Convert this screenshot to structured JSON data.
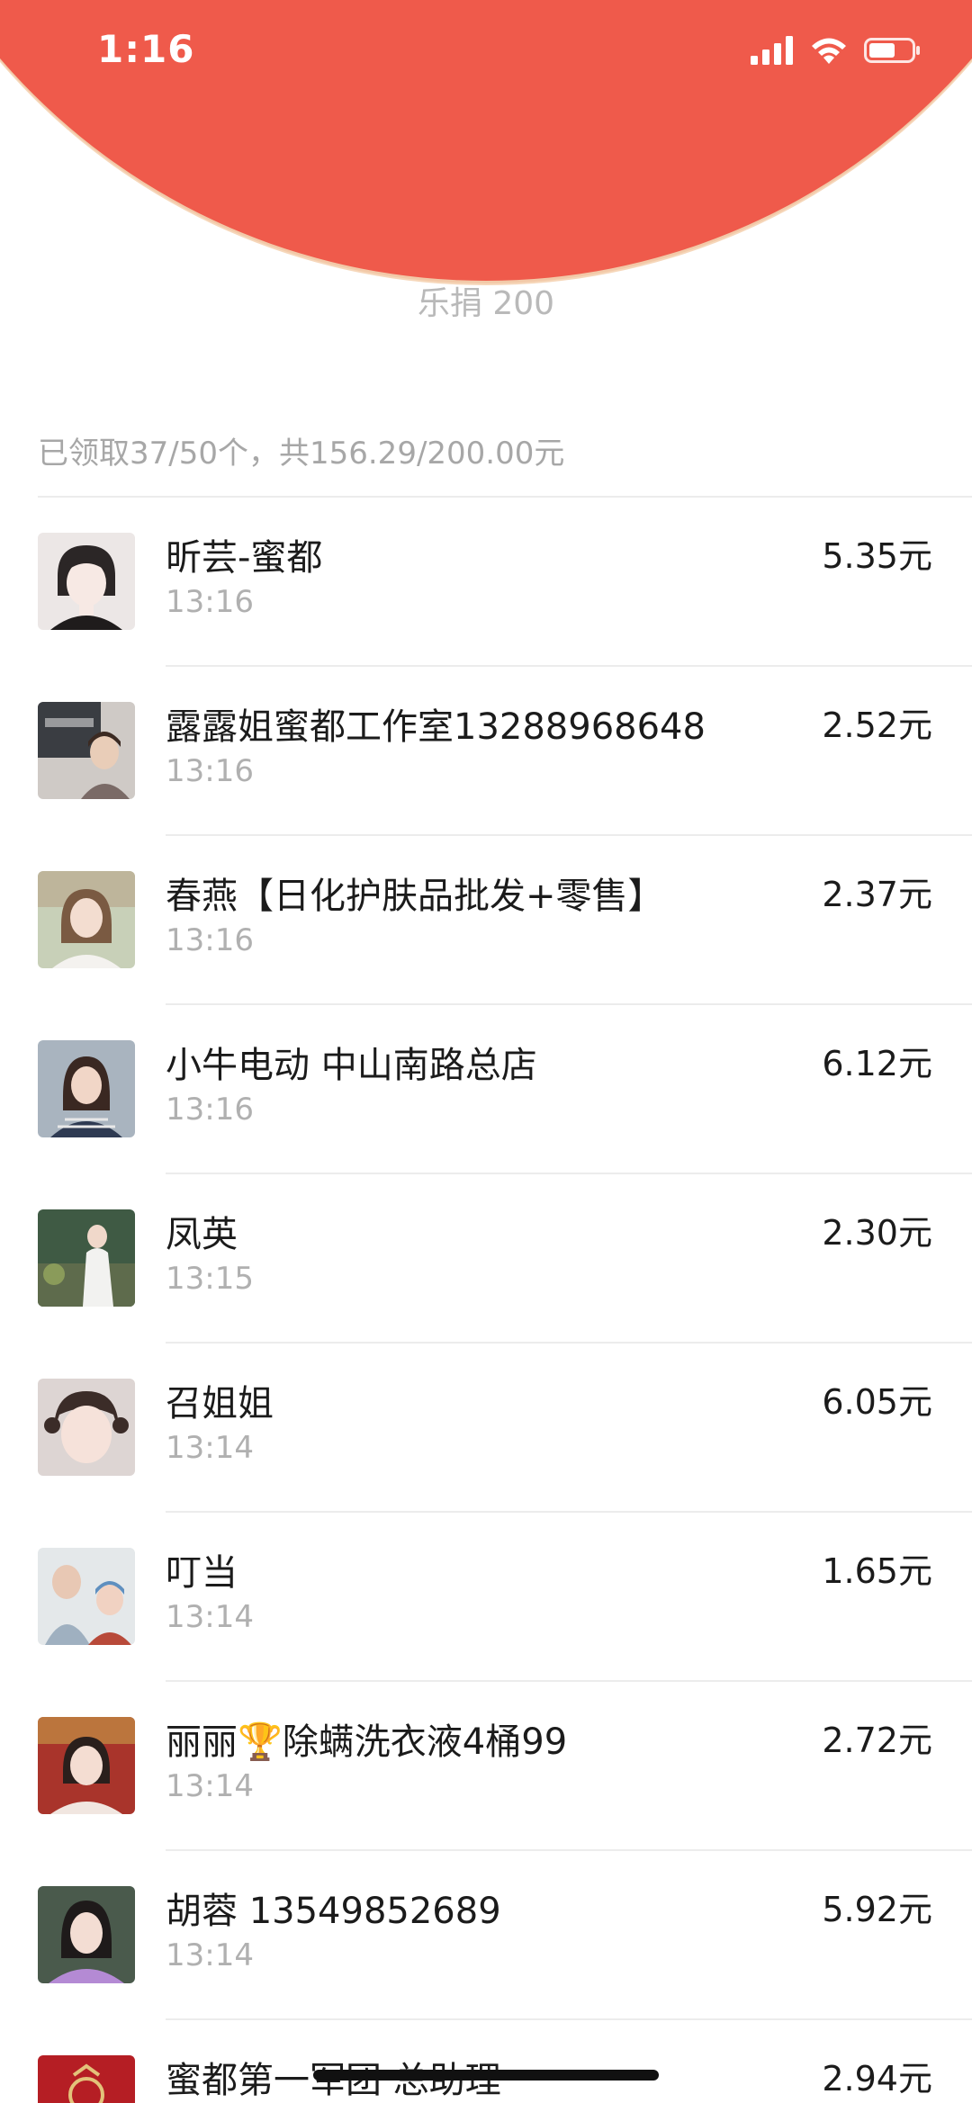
{
  "status_bar": {
    "time": "1:16",
    "icons": [
      "signal-icon",
      "wifi-icon",
      "battery-icon"
    ]
  },
  "nav": {
    "back_icon": "chevron-left-icon",
    "more_icon": "more-dots-icon"
  },
  "colors": {
    "header_red": "#ef5a4b",
    "header_rim": "#f2c9a8",
    "muted_text": "#b0b0b0"
  },
  "subtitle": "乐捐 200",
  "summary": "已领取37/50个，共156.29/200.00元",
  "recipients": [
    {
      "name": "昕芸-蜜都",
      "time": "13:16",
      "amount": "5.35元"
    },
    {
      "name": "露露姐蜜都工作室13288968648",
      "time": "13:16",
      "amount": "2.52元"
    },
    {
      "name": "春燕【日化护肤品批发+零售】",
      "time": "13:16",
      "amount": "2.37元"
    },
    {
      "name": "小牛电动  中山南路总店",
      "time": "13:16",
      "amount": "6.12元"
    },
    {
      "name": "凤英",
      "time": "13:15",
      "amount": "2.30元"
    },
    {
      "name": "召姐姐",
      "time": "13:14",
      "amount": "6.05元"
    },
    {
      "name": "叮当",
      "time": "13:14",
      "amount": "1.65元"
    },
    {
      "name": "丽丽🏆除螨洗衣液4桶99",
      "time": "13:14",
      "amount": "2.72元"
    },
    {
      "name": "胡蓉 13549852689",
      "time": "13:14",
      "amount": "5.92元"
    },
    {
      "name": "蜜都第一军团 总助理",
      "time": "",
      "amount": "2.94元"
    }
  ]
}
